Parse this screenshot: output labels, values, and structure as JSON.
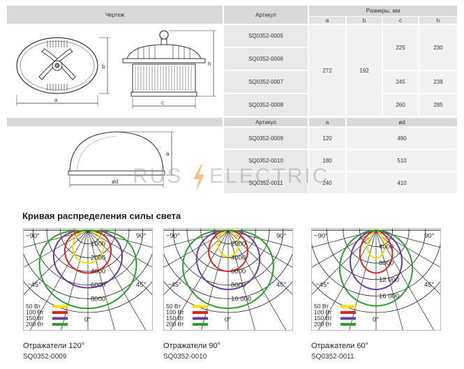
{
  "table1": {
    "header_drawing": "Чертеж",
    "header_article": "Артикул",
    "header_dimensions": "Размеры, мм",
    "sub_a": "a",
    "sub_b": "b",
    "sub_c": "c",
    "sub_h": "h",
    "articles": [
      "SQ0352-0005",
      "SQ0352-0006",
      "SQ0352-0007",
      "SQ0352-0008"
    ],
    "a_value": "272",
    "b_value": "192",
    "c_values": [
      "225",
      "245",
      "260"
    ],
    "h_values": [
      "230",
      "238",
      "285"
    ]
  },
  "table2": {
    "header_article": "Артикул",
    "header_a": "a",
    "header_od": "ød",
    "articles": [
      "SQ0352-0009",
      "SQ0352-0010",
      "SQ0352-0011"
    ],
    "a_values": [
      "120",
      "180",
      "240"
    ],
    "od_values": [
      "490",
      "510",
      "410"
    ]
  },
  "drawing_labels": {
    "a": "a",
    "b": "b",
    "c": "c",
    "h": "h",
    "od": "ød",
    "a2": "a"
  },
  "watermark": {
    "left": "RUS",
    "right": "ELECTRIC"
  },
  "section_title": "Кривая распределения силы света",
  "polar_common": {
    "angle_left": "−90°",
    "angle_right": "90°",
    "angle_left45": "−45°",
    "angle_right45": "45°",
    "angle_zero": "0°",
    "legend": [
      {
        "label": "50 Вт",
        "color": "#f2e000"
      },
      {
        "label": "100 Вт",
        "color": "#e2231a"
      },
      {
        "label": "150 Вт",
        "color": "#6a3d9a"
      },
      {
        "label": "200 Вт",
        "color": "#2aa02a"
      }
    ]
  },
  "diagrams": [
    {
      "rings": [
        "1000",
        "2000",
        "4000",
        "6000",
        "8000"
      ],
      "caption": "Отражатели 120°",
      "article": "SQ0352-0009"
    },
    {
      "rings": [
        "2000",
        "4000",
        "6000",
        "8000",
        "10 000"
      ],
      "caption": "Отражатели 90°",
      "article": "SQ0352-0010"
    },
    {
      "rings": [
        "4000",
        "8000",
        "12 000",
        "16 000"
      ],
      "caption": "Отражатели 60°",
      "article": "SQ0352-0011"
    }
  ]
}
